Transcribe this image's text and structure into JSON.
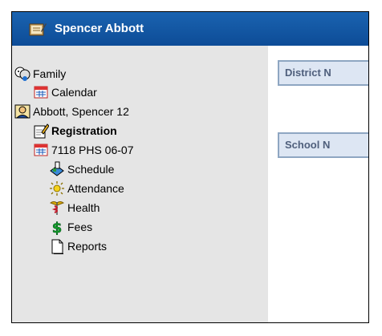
{
  "header": {
    "title": "Spencer Abbott"
  },
  "nav": {
    "family": "Family",
    "calendar": "Calendar",
    "student": "Abbott, Spencer 12",
    "registration": "Registration",
    "enrollment": "7118 PHS 06-07",
    "schedule": "Schedule",
    "attendance": "Attendance",
    "health": "Health",
    "fees": "Fees",
    "reports": "Reports"
  },
  "content": {
    "district_notice": "District N",
    "school_notice": "School N"
  }
}
